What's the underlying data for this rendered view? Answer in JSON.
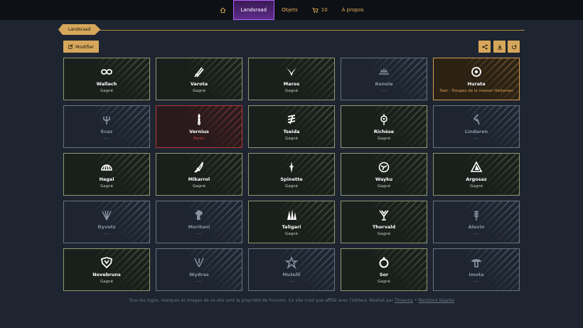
{
  "nav": {
    "home_icon": "home-icon",
    "items": [
      {
        "label": "Landsraad",
        "active": true
      },
      {
        "label": "Objets",
        "active": false
      }
    ],
    "cart_count": "10",
    "about": "À propos"
  },
  "breadcrumb": "Landsraad",
  "toolbar": {
    "edit_label": "Modifier",
    "share_icon": "share-icon",
    "download_icon": "download-icon",
    "reset_icon": "reset-icon"
  },
  "colors": {
    "accent": "#d6a75b",
    "won": "#8a9a74",
    "unknown": "#6a7282",
    "lost": "#b03a3a",
    "kill": "#d39a52"
  },
  "houses": [
    {
      "name": "Wallach",
      "status": "Gagné",
      "state": "won",
      "icon": "knot-icon"
    },
    {
      "name": "Varota",
      "status": "Gagné",
      "state": "won",
      "icon": "blades-icon"
    },
    {
      "name": "Maros",
      "status": "Gagné",
      "state": "won",
      "icon": "horns-icon"
    },
    {
      "name": "Kenola",
      "status": "----",
      "state": "unk",
      "icon": "sunrise-icon"
    },
    {
      "name": "Hurata",
      "status": "Tuer : Troupes de la maison Harkonen",
      "state": "kill",
      "icon": "eye-icon"
    },
    {
      "name": "Ecaz",
      "status": "----",
      "state": "unk",
      "icon": "trident-icon"
    },
    {
      "name": "Vernius",
      "status": "Perdu",
      "state": "lost",
      "icon": "flame-icon"
    },
    {
      "name": "Tseida",
      "status": "Gagné",
      "state": "won",
      "icon": "wave-icon"
    },
    {
      "name": "Richèse",
      "status": "Gagné",
      "state": "won",
      "icon": "lantern-icon"
    },
    {
      "name": "Lindaren",
      "status": "----",
      "state": "unk",
      "icon": "rune-icon"
    },
    {
      "name": "Hagal",
      "status": "Gagné",
      "state": "won",
      "icon": "shell-icon"
    },
    {
      "name": "Mikarrol",
      "status": "Gagné",
      "state": "won",
      "icon": "ship-icon"
    },
    {
      "name": "Spinette",
      "status": "Gagné",
      "state": "won",
      "icon": "needle-icon"
    },
    {
      "name": "Wayku",
      "status": "Gagné",
      "state": "won",
      "icon": "orb-icon"
    },
    {
      "name": "Argosaz",
      "status": "Gagné",
      "state": "won",
      "icon": "triangle-icon"
    },
    {
      "name": "Dyvetz",
      "status": "----",
      "state": "unk",
      "icon": "fan-icon"
    },
    {
      "name": "Moritani",
      "status": "----",
      "state": "unk",
      "icon": "horse-icon"
    },
    {
      "name": "Taligari",
      "status": "Gagné",
      "state": "won",
      "icon": "spires-icon"
    },
    {
      "name": "Thorvald",
      "status": "Gagné",
      "state": "won",
      "icon": "cup-icon"
    },
    {
      "name": "Alexin",
      "status": "----",
      "state": "unk",
      "icon": "wheat-icon"
    },
    {
      "name": "Novebruns",
      "status": "Gagné",
      "state": "won",
      "icon": "shield-icon"
    },
    {
      "name": "Wydras",
      "status": "----",
      "state": "unk",
      "icon": "claws-icon"
    },
    {
      "name": "Mutelli",
      "status": "----",
      "state": "unk",
      "icon": "star-icon"
    },
    {
      "name": "Sor",
      "status": "Gagné",
      "state": "won",
      "icon": "ring-icon"
    },
    {
      "name": "Imota",
      "status": "----",
      "state": "unk",
      "icon": "mushroom-icon"
    }
  ],
  "footer": {
    "text": "Tous les logos, marques et images de ce site sont la propriété de Funcom. Ce site n'est pas affilié avec l'éditeur. Réalisé par",
    "author": "Thoanny",
    "separator": "•",
    "legal": "Mentions légales"
  }
}
